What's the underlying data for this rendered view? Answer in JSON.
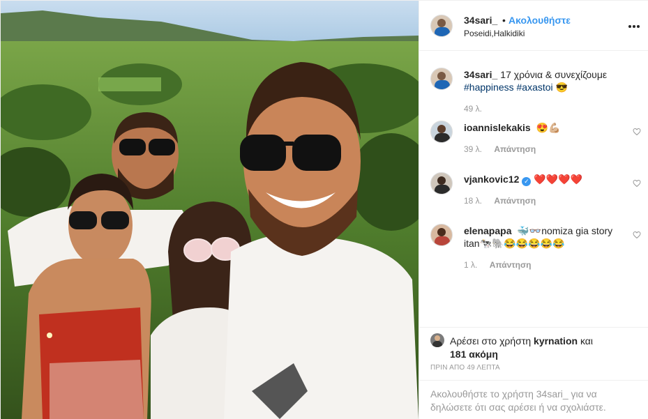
{
  "post": {
    "username": "34sari_",
    "separator": "•",
    "follow_label": "Ακολουθήστε",
    "location": "Poseidi,Halkidiki",
    "more_icon": "more-options-icon"
  },
  "caption": {
    "username": "34sari_",
    "text": "17 χρόνια & συνεχίζουμε",
    "hashtags": [
      "#happiness",
      "#axastoi"
    ],
    "emoji": "😎",
    "age": "49 λ."
  },
  "comments": [
    {
      "username": "ioannislekakis",
      "text": "😍💪🏼",
      "age": "39 λ.",
      "reply_label": "Απάντηση",
      "verified": false
    },
    {
      "username": "vjankovic12",
      "text": "❤️❤️❤️❤️",
      "age": "18 λ.",
      "reply_label": "Απάντηση",
      "verified": true
    },
    {
      "username": "elenapapa",
      "text": "🐳👓nomiza gia story itan🐄🐘😂😂😂😂😂",
      "age": "1 λ.",
      "reply_label": "Απάντηση",
      "verified": false
    }
  ],
  "likes": {
    "prefix": "Αρέσει στο χρήστη",
    "user": "kyrnation",
    "conjunction": "και",
    "others": "181 ακόμη",
    "time": "ΠΡΙΝ ΑΠΟ 49 ΛΕΠΤΑ"
  },
  "login_prompt": {
    "text": "Ακολουθήστε το χρήστη 34sari_ για να δηλώσετε ότι σας αρέσει ή να σχολιάστε."
  },
  "colors": {
    "link_blue": "#3897f0",
    "hashtag": "#003569",
    "muted": "#999999",
    "text": "#262626",
    "border": "#efefef"
  }
}
